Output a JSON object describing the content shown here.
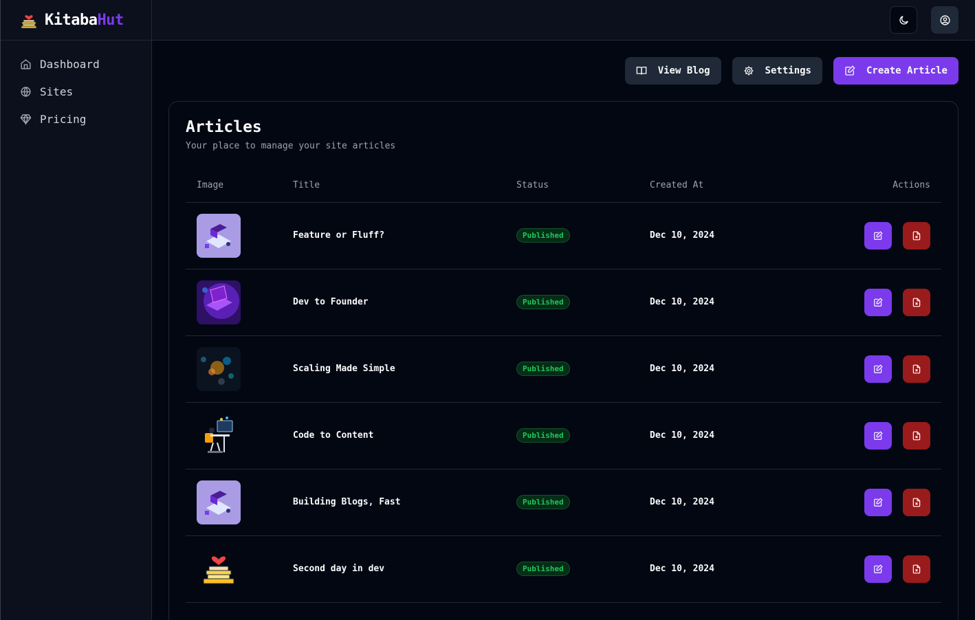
{
  "brand": {
    "name_main": "Kitaba",
    "name_accent": "Hut"
  },
  "sidebar": {
    "items": [
      {
        "label": "Dashboard",
        "icon": "home-icon"
      },
      {
        "label": "Sites",
        "icon": "globe-icon"
      },
      {
        "label": "Pricing",
        "icon": "diamond-icon"
      }
    ]
  },
  "header": {
    "theme_icon": "moon-icon",
    "user_icon": "user-circle-icon"
  },
  "toolbar": {
    "view_blog": "View Blog",
    "settings": "Settings",
    "create_article": "Create Article"
  },
  "articles": {
    "title": "Articles",
    "subtitle": "Your place to manage your site articles",
    "columns": [
      "Image",
      "Title",
      "Status",
      "Created At",
      "Actions"
    ],
    "rows": [
      {
        "title": "Feature or Fluff?",
        "status": "Published",
        "created_at": "Dec 10, 2024",
        "thumb": "laptop-iso-lavender"
      },
      {
        "title": "Dev to Founder",
        "status": "Published",
        "created_at": "Dec 10, 2024",
        "thumb": "laptop-purple-neon"
      },
      {
        "title": "Scaling Made Simple",
        "status": "Published",
        "created_at": "Dec 10, 2024",
        "thumb": "dark-bokeh"
      },
      {
        "title": "Code to Content",
        "status": "Published",
        "created_at": "Dec 10, 2024",
        "thumb": "developer-desk"
      },
      {
        "title": "Building Blogs, Fast",
        "status": "Published",
        "created_at": "Dec 10, 2024",
        "thumb": "laptop-iso-lavender"
      },
      {
        "title": "Second day in dev",
        "status": "Published",
        "created_at": "Dec 10, 2024",
        "thumb": "books-heart-logo"
      }
    ]
  },
  "colors": {
    "accent": "#7c3aed",
    "danger": "#991b1b",
    "success": "#22c55e",
    "background": "#030712"
  }
}
